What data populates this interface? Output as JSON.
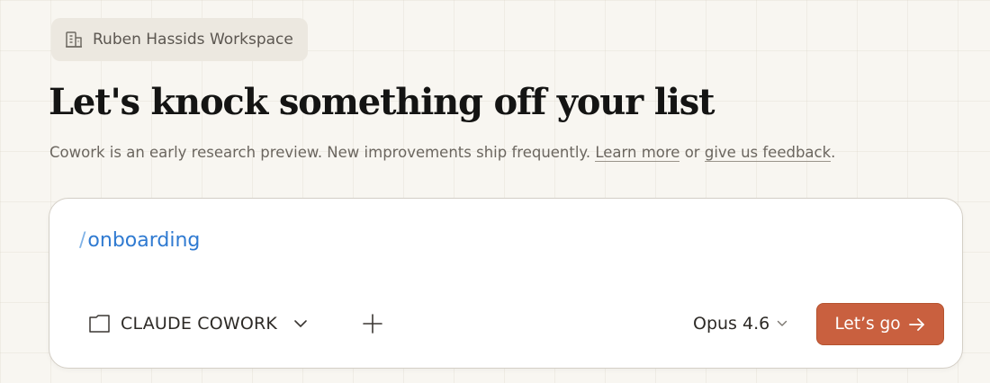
{
  "workspace": {
    "name": "Ruben Hassids Workspace",
    "icon": "building-icon"
  },
  "hero": {
    "title": "Let's knock something off your list",
    "subtitle_prefix": "Cowork is an early research preview. New improvements ship frequently.",
    "learn_more_link": "Learn more",
    "or_text": "or",
    "feedback_link": "give us feedback",
    "subtitle_suffix": "."
  },
  "composer": {
    "slash": "/",
    "command": "onboarding",
    "folder": {
      "icon": "folder-icon",
      "label": "CLAUDE COWORK",
      "caret_icon": "chevron-down-icon"
    },
    "add_icon": "plus-icon",
    "model": {
      "label": "Opus 4.6",
      "caret_icon": "chevron-down-icon"
    },
    "submit": {
      "label": "Let’s go",
      "icon": "arrow-right-icon"
    }
  },
  "colors": {
    "accent": "#c9603f",
    "command": "#2f7ad1",
    "background": "#f8f6f1"
  }
}
